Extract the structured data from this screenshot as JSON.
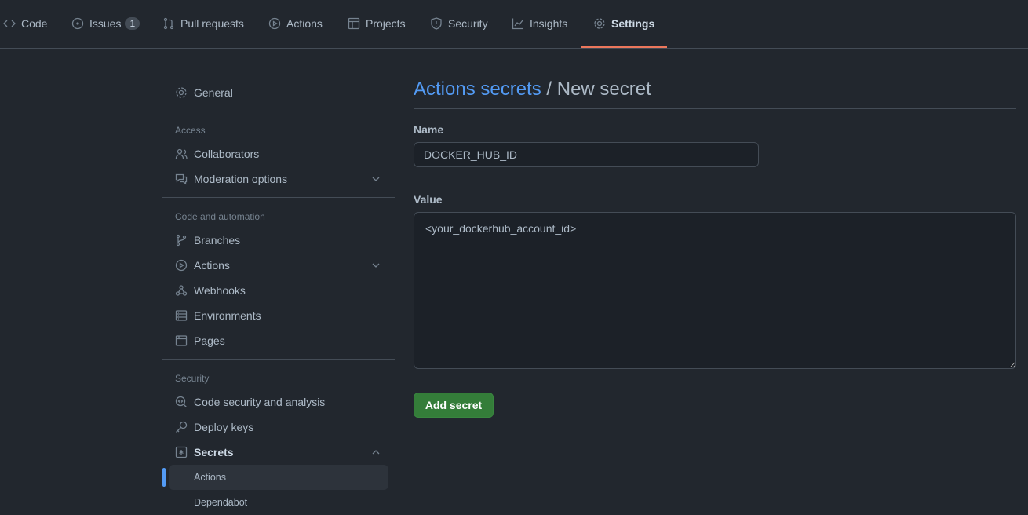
{
  "nav": {
    "tabs": [
      {
        "label": "Code",
        "icon": "code-icon"
      },
      {
        "label": "Issues",
        "icon": "issue-icon",
        "count": "1"
      },
      {
        "label": "Pull requests",
        "icon": "pull-request-icon"
      },
      {
        "label": "Actions",
        "icon": "play-icon"
      },
      {
        "label": "Projects",
        "icon": "table-icon"
      },
      {
        "label": "Security",
        "icon": "shield-icon"
      },
      {
        "label": "Insights",
        "icon": "graph-icon"
      },
      {
        "label": "Settings",
        "icon": "gear-icon",
        "selected": true
      }
    ]
  },
  "sidebar": {
    "general": "General",
    "access_heading": "Access",
    "collaborators": "Collaborators",
    "moderation": "Moderation options",
    "code_heading": "Code and automation",
    "branches": "Branches",
    "actions": "Actions",
    "webhooks": "Webhooks",
    "environments": "Environments",
    "pages": "Pages",
    "security_heading": "Security",
    "code_security": "Code security and analysis",
    "deploy_keys": "Deploy keys",
    "secrets": "Secrets",
    "secrets_actions": "Actions",
    "secrets_dependabot": "Dependabot"
  },
  "main": {
    "breadcrumb_link": "Actions secrets",
    "title_sep": " / ",
    "title": "New secret",
    "name_label": "Name",
    "name_value": "DOCKER_HUB_ID",
    "value_label": "Value",
    "value_value": "<your_dockerhub_account_id>",
    "add_button": "Add secret"
  },
  "colors": {
    "accent": "#539bf5",
    "button": "#347d39",
    "tab_underline": "#ec775c",
    "background": "#22272e"
  }
}
